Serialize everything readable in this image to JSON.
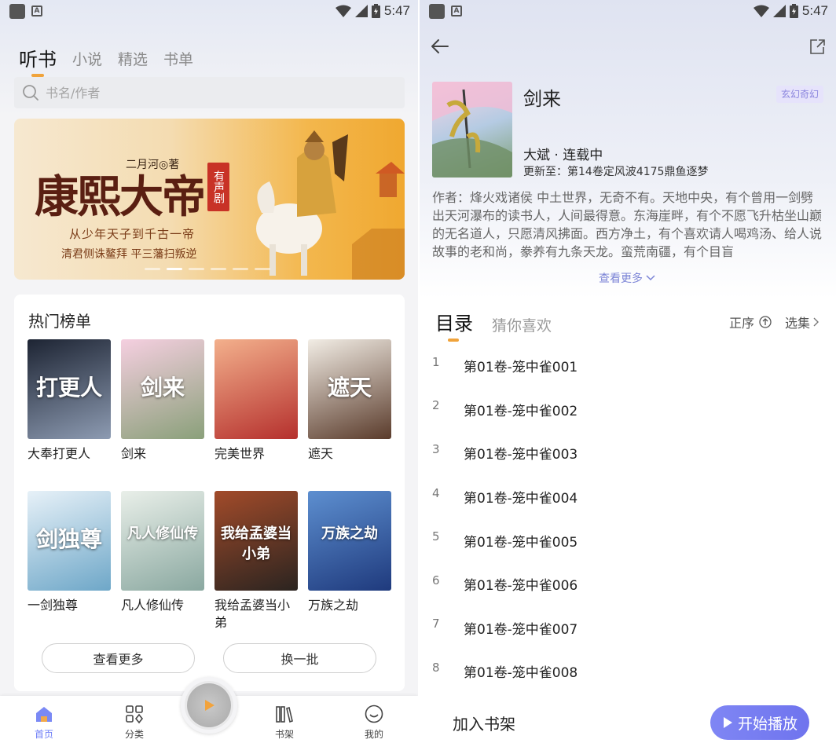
{
  "status_bar": {
    "time": "5:47"
  },
  "left": {
    "tabs": [
      {
        "label": "听书",
        "active": true
      },
      {
        "label": "小说",
        "active": false
      },
      {
        "label": "精选",
        "active": false
      },
      {
        "label": "书单",
        "active": false
      }
    ],
    "search": {
      "placeholder": "书名/作者"
    },
    "banner": {
      "author": "二月河◎著",
      "title": "康熙大帝",
      "badge": "有声剧",
      "line1": "从少年天子到千古一帝",
      "line2": "清君侧诛鳌拜 平三藩扫叛逆",
      "dot_count": 6,
      "active_dot": 1
    },
    "hot_list": {
      "title": "热门榜单",
      "books": [
        {
          "title": "大奉打更人",
          "cover_text": "打更人",
          "colors": [
            "#1d2433",
            "#8d9bb2"
          ]
        },
        {
          "title": "剑来",
          "cover_text": "剑来",
          "colors": [
            "#f5cfe0",
            "#8aa07a"
          ]
        },
        {
          "title": "完美世界",
          "cover_text": "",
          "colors": [
            "#f3b08c",
            "#b5302d"
          ]
        },
        {
          "title": "遮天",
          "cover_text": "遮天",
          "colors": [
            "#f2ede5",
            "#5a3b2b"
          ]
        },
        {
          "title": "一剑独尊",
          "cover_text": "剑独尊",
          "colors": [
            "#e7f1f8",
            "#6ea7c8"
          ]
        },
        {
          "title": "凡人修仙传",
          "cover_text": "凡人修仙传",
          "colors": [
            "#e9efe9",
            "#8aa8a0"
          ]
        },
        {
          "title": "我给孟婆当小弟",
          "cover_text": "我给孟婆当小弟",
          "colors": [
            "#a24b2a",
            "#2b2420"
          ]
        },
        {
          "title": "万族之劫",
          "cover_text": "万族之劫",
          "colors": [
            "#5d8fd0",
            "#1f3a7d"
          ]
        }
      ],
      "more_label": "查看更多",
      "refresh_label": "换一批"
    },
    "nav": [
      {
        "label": "首页",
        "icon": "home-icon",
        "active": true
      },
      {
        "label": "分类",
        "icon": "category-icon",
        "active": false
      },
      {
        "label": "书架",
        "icon": "bookshelf-icon",
        "active": false
      },
      {
        "label": "我的",
        "icon": "profile-icon",
        "active": false
      }
    ]
  },
  "right": {
    "book": {
      "title": "剑来",
      "genre": "玄幻奇幻",
      "status": "大斌 · 连载中",
      "updated": "更新至：第14卷定风波4175鼎鱼逐梦",
      "description": "作者：烽火戏诸侯 中土世界，无奇不有。天地中央，有个曾用一剑劈出天河瀑布的读书人，人间最得意。东海崖畔，有个不愿飞升枯坐山巅的无名道人，只愿清风拂面。西方净土，有个喜欢请人喝鸡汤、给人说故事的老和尚，豢养有九条天龙。蛮荒南疆，有个目盲",
      "see_more": "查看更多"
    },
    "tabs": [
      {
        "label": "目录",
        "active": true
      },
      {
        "label": "猜你喜欢",
        "active": false
      }
    ],
    "sort_label": "正序",
    "select_label": "选集",
    "chapters": [
      {
        "num": "1",
        "title": "第01卷-笼中雀001"
      },
      {
        "num": "2",
        "title": "第01卷-笼中雀002"
      },
      {
        "num": "3",
        "title": "第01卷-笼中雀003"
      },
      {
        "num": "4",
        "title": "第01卷-笼中雀004"
      },
      {
        "num": "5",
        "title": "第01卷-笼中雀005"
      },
      {
        "num": "6",
        "title": "第01卷-笼中雀006"
      },
      {
        "num": "7",
        "title": "第01卷-笼中雀007"
      },
      {
        "num": "8",
        "title": "第01卷-笼中雀008"
      }
    ],
    "add_shelf_label": "加入书架",
    "start_label": "开始播放"
  }
}
